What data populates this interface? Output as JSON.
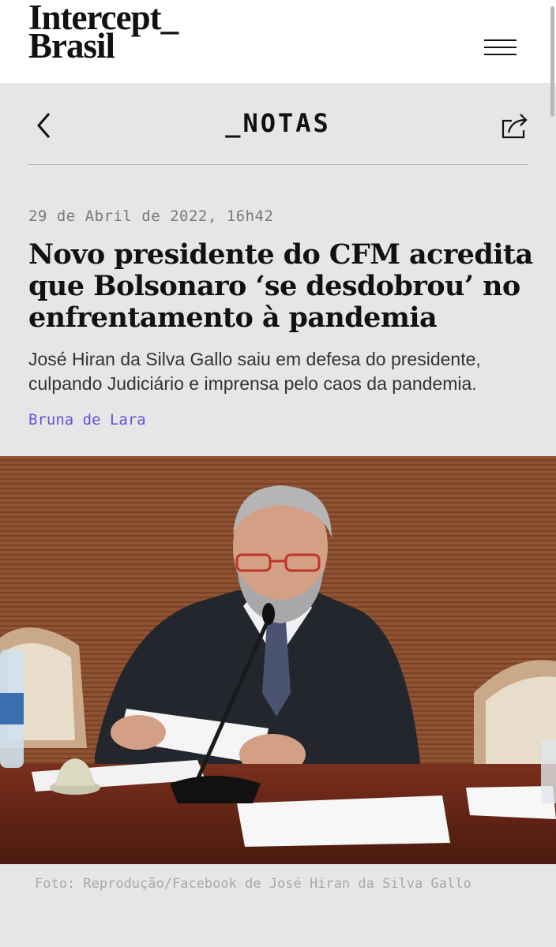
{
  "brand": {
    "line1": "Intercept_",
    "line2": "Brasil"
  },
  "section": {
    "title": "_NOTAS"
  },
  "article": {
    "date": "29 de Abril de 2022, 16h42",
    "headline": "Novo presidente do CFM acredita que Bolsonaro ‘se desdobrou’ no enfrentamento à pandemia",
    "subtitle": "José Hiran da Silva Gallo saiu em defesa do presidente, culpando Judiciário e imprensa pelo caos da pandemia.",
    "author": "Bruna de Lara",
    "photo_caption": "Foto: Reprodução/Facebook de José Hiran da Silva Gallo"
  },
  "icons": {
    "menu": "hamburger-menu-icon",
    "back": "chevron-left-icon",
    "share": "share-icon"
  },
  "colors": {
    "accent_author": "#6a50d4",
    "background": "#e6e6e6",
    "header": "#ffffff"
  }
}
